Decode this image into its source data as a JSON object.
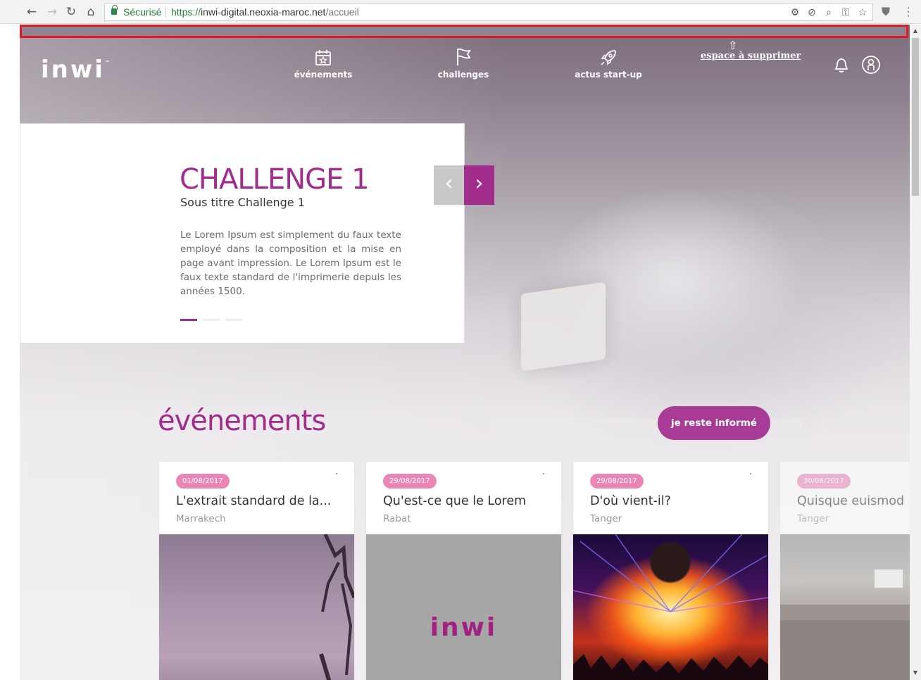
{
  "browser": {
    "secure_label": "Sécurisé",
    "url_protocol": "https://",
    "url_host": "inwi-digital.neoxia-maroc.net",
    "url_path": "/accueil"
  },
  "header": {
    "logo_text": "inwi",
    "logo_tm": "™",
    "nav": [
      {
        "label": "événements",
        "icon": "calendar-star-icon"
      },
      {
        "label": "challenges",
        "icon": "flag-icon"
      },
      {
        "label": "actus start-up",
        "icon": "rocket-icon"
      }
    ],
    "annotation": "espace à supprimer",
    "annotation_color": "#e01a22"
  },
  "slider": {
    "title": "CHALLENGE 1",
    "subtitle": "Sous titre Challenge 1",
    "text": "Le Lorem Ipsum est simplement du faux texte employé dans la composition et la mise en page avant impression. Le Lorem Ipsum est le faux texte standard de l'imprimerie depuis les années 1500.",
    "prev_symbol": "‹",
    "next_symbol": "›",
    "dots": 3,
    "active_dot": 1
  },
  "events": {
    "title": "événements",
    "inform_button": "je reste informé",
    "cards": [
      {
        "date": "01/08/2017",
        "title": "L'extrait standard de la...",
        "city": "Marrakech"
      },
      {
        "date": "29/08/2017",
        "title": "Qu'est-ce que le Lorem",
        "city": "Rabat",
        "image_logo": "inwi"
      },
      {
        "date": "29/08/2017",
        "title": "D'où vient-il?",
        "city": "Tanger"
      },
      {
        "date": "30/08/2017",
        "title": "Quisque euismod",
        "city": "Tanger"
      }
    ]
  },
  "colors": {
    "brand": "#a12c8b",
    "button": "#a83b96",
    "date_badge": "#ea86b6"
  }
}
